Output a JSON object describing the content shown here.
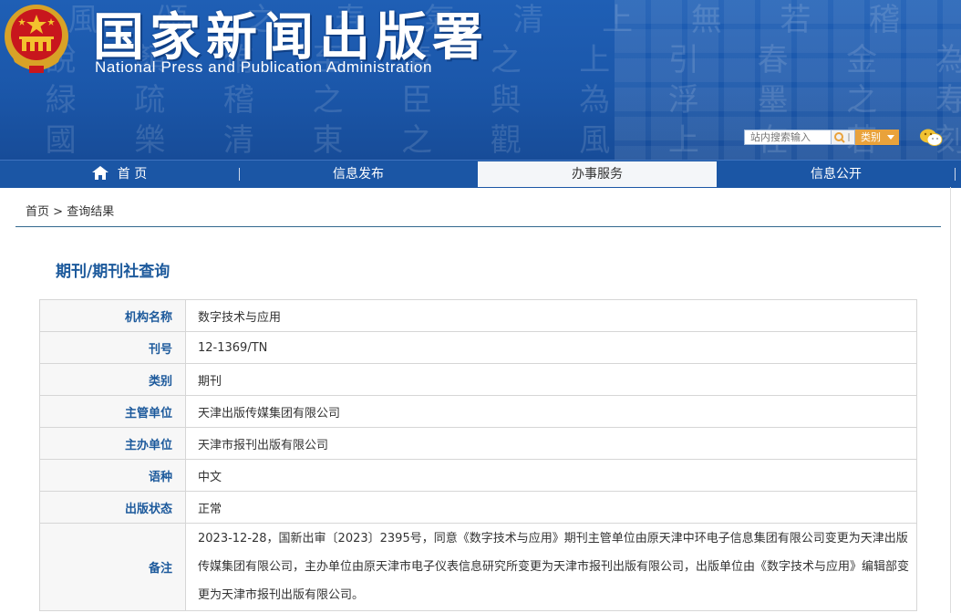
{
  "header": {
    "title_cn": "国家新闻出版署",
    "title_en": "National Press and Publication Administration",
    "search_placeholder": "站内搜索输入",
    "category_label": "类别"
  },
  "nav": {
    "items": [
      {
        "label": "首 页"
      },
      {
        "label": "信息发布"
      },
      {
        "label": "办事服务"
      },
      {
        "label": "信息公开"
      }
    ]
  },
  "breadcrumb": {
    "home": "首页",
    "separator": ">",
    "current": "查询结果"
  },
  "page_title": "期刊/期刊社查询",
  "record": {
    "rows": [
      {
        "label": "机构名称",
        "value": "数字技术与应用"
      },
      {
        "label": "刊号",
        "value": "12-1369/TN"
      },
      {
        "label": "类别",
        "value": "期刊"
      },
      {
        "label": "主管单位",
        "value": "天津出版传媒集团有限公司"
      },
      {
        "label": "主办单位",
        "value": "天津市报刊出版有限公司"
      },
      {
        "label": "语种",
        "value": "中文"
      },
      {
        "label": "出版状态",
        "value": "正常"
      }
    ],
    "note": {
      "label": "备注",
      "value": "2023-12-28，国新出审〔2023〕2395号，同意《数字技术与应用》期刊主管单位由原天津中环电子信息集团有限公司变更为天津出版传媒集团有限公司，主办单位由原天津市电子仪表信息研究所变更为天津市报刊出版有限公司，出版单位由《数字技术与应用》编辑部变更为天津市报刊出版有限公司。"
    }
  },
  "colors": {
    "banner_blue": "#1b57aa",
    "nav_blue": "#1b56a5",
    "label_blue": "#1d5a9c",
    "category_orange": "#e9a23b"
  }
}
